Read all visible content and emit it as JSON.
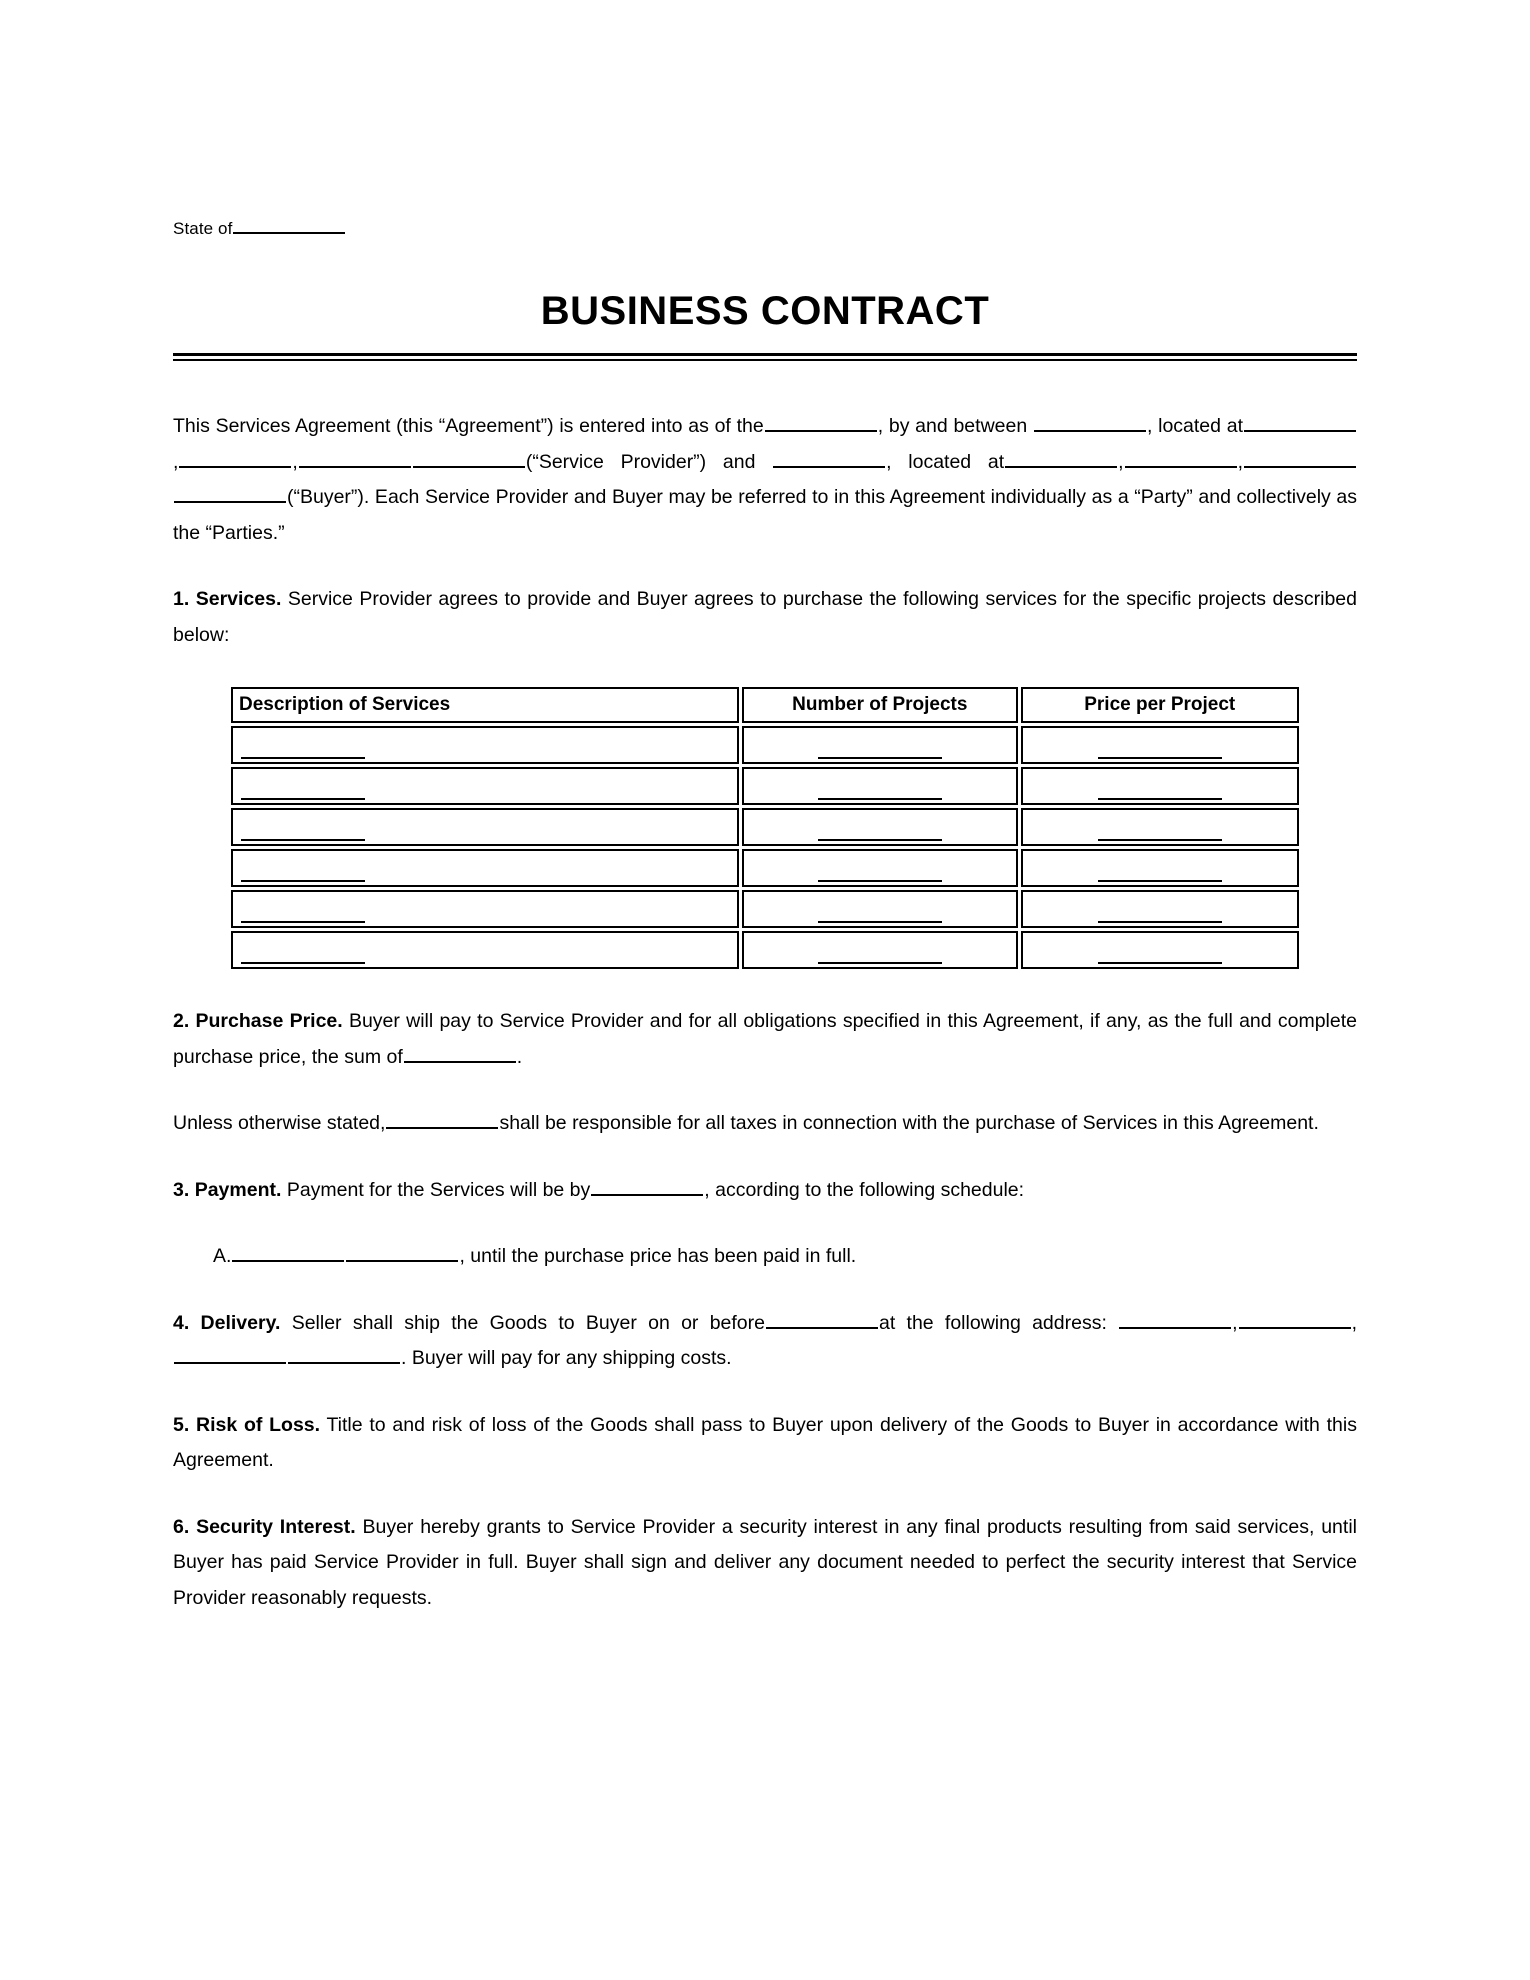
{
  "document": {
    "state_label": "State of",
    "title": "BUSINESS CONTRACT"
  },
  "intro": {
    "t1": "This Services Agreement (this “Agreement”) is entered into as of the",
    "t2": ", by and between",
    "t3": ", located at",
    "t4": "(“Service Provider”) and",
    "t5": ", located at",
    "t6": "(“Buyer”). Each Service Provider and Buyer may be referred to in this Agreement individually as a “Party” and collectively as the “Parties.”"
  },
  "sections": [
    {
      "number": "1.",
      "heading": "Services.",
      "body": "Service Provider agrees to provide and Buyer agrees to purchase the following services for the specific projects described below:"
    },
    {
      "number": "2.",
      "heading": "Purchase Price.",
      "body_1": "Buyer will pay to Service Provider and for all obligations specified in this Agreement, if any, as the full and complete purchase price, the sum of",
      "body_2": "."
    },
    {
      "number": "3.",
      "heading": "Payment.",
      "body_1": "Payment for the Services will be by",
      "body_2": ", according to the following schedule:"
    },
    {
      "number": "4.",
      "heading": "Delivery.",
      "body_1": "Seller shall ship the Goods to Buyer on or before",
      "body_2": "at the following address:",
      "body_3": ". Buyer will pay for any shipping costs."
    },
    {
      "number": "5.",
      "heading": "Risk of Loss.",
      "body": "Title to and risk of loss of the Goods shall pass to Buyer upon delivery of the Goods to Buyer in accordance with this Agreement."
    },
    {
      "number": "6.",
      "heading": "Security Interest.",
      "body": "Buyer hereby grants to Service Provider a security interest in any final products resulting from said services, until Buyer has paid Service Provider in full. Buyer shall sign and deliver any document needed to perfect the security interest that Service Provider reasonably requests."
    }
  ],
  "taxes_clause": {
    "t1": "Unless otherwise stated,",
    "t2": "shall be responsible for all taxes in connection with the purchase of Services in this Agreement."
  },
  "payment_schedule": {
    "marker": "A.",
    "text": ", until the purchase price has been paid in full."
  },
  "services_table": {
    "headers": [
      "Description of Services",
      "Number of Projects",
      "Price per Project"
    ],
    "rows": [
      [
        "",
        "",
        ""
      ],
      [
        "",
        "",
        ""
      ],
      [
        "",
        "",
        ""
      ],
      [
        "",
        "",
        ""
      ],
      [
        "",
        "",
        ""
      ],
      [
        "",
        "",
        ""
      ]
    ]
  }
}
